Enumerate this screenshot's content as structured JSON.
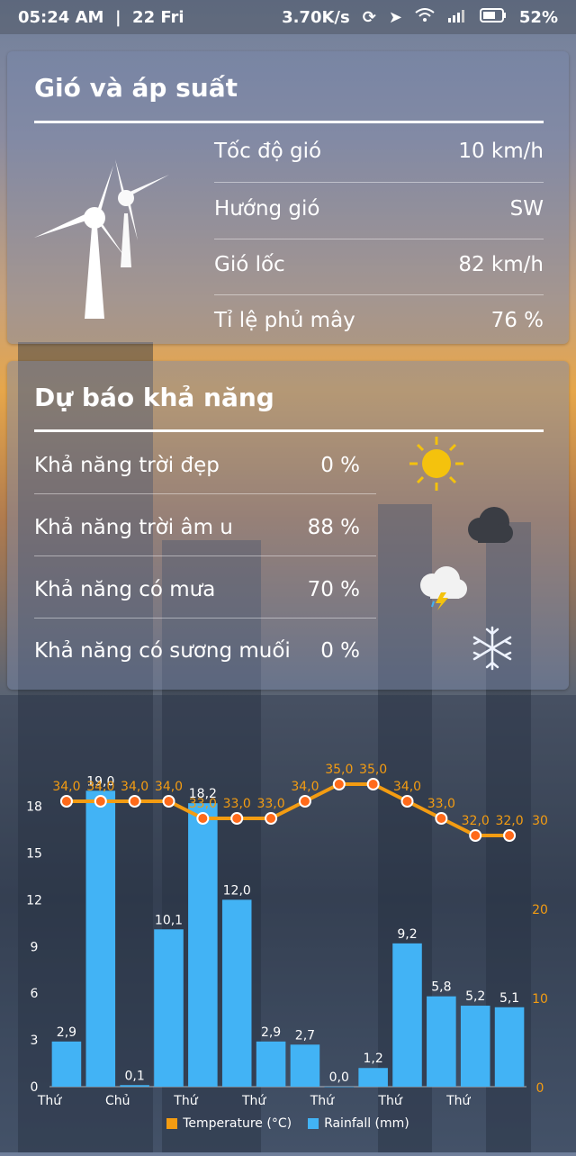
{
  "status_bar": {
    "time_date": "05:24 AM  |  22 Fri",
    "speed": "3.70K/s",
    "battery": "52%"
  },
  "wind_card": {
    "title": "Gió và áp suất",
    "icon": "wind-turbine-icon",
    "rows": [
      {
        "label": "Tốc độ gió",
        "value": "10 km/h"
      },
      {
        "label": "Hướng gió",
        "value": "SW"
      },
      {
        "label": "Gió lốc",
        "value": "82 km/h"
      },
      {
        "label": "Tỉ lệ phủ mây",
        "value": "76 %"
      }
    ]
  },
  "forecast_card": {
    "title": "Dự báo khả năng",
    "rows": [
      {
        "label": "Khả năng trời đẹp",
        "value": "0 %",
        "icon": "sun-icon"
      },
      {
        "label": "Khả năng trời âm u",
        "value": "88 %",
        "icon": "cloud-icon"
      },
      {
        "label": "Khả năng có mưa",
        "value": "70 %",
        "icon": "thunderstorm-icon"
      },
      {
        "label": "Khả năng có sương muối",
        "value": "0 %",
        "icon": "snowflake-icon"
      }
    ]
  },
  "colors": {
    "temperature": "#f39c12",
    "rainfall": "#42b3f5"
  },
  "chart_data": {
    "type": "bar+line",
    "x_tick_labels": [
      "Thứ",
      "Chủ",
      "Thứ",
      "Thứ",
      "Thứ",
      "Thứ",
      "Thứ"
    ],
    "series": [
      {
        "name": "Temperature (°C)",
        "type": "line",
        "axis": "right",
        "values": [
          34.0,
          34.0,
          34.0,
          34.0,
          33.0,
          33.0,
          33.0,
          34.0,
          35.0,
          35.0,
          34.0,
          33.0,
          32.0,
          32.0
        ],
        "labels": [
          "34,0",
          "34,0",
          "34,0",
          "34,0",
          "33,0",
          "33,0",
          "33,0",
          "34,0",
          "35,0",
          "35,0",
          "34,0",
          "33,0",
          "32,0",
          "32,0"
        ]
      },
      {
        "name": "Rainfall (mm)",
        "type": "bar",
        "axis": "left",
        "values": [
          2.9,
          19.0,
          0.1,
          10.1,
          18.2,
          12.0,
          2.9,
          2.7,
          0.0,
          1.2,
          9.2,
          5.8,
          5.2,
          5.1
        ],
        "labels": [
          "2,9",
          "19,0",
          "0,1",
          "10,1",
          "18,2",
          "12,0",
          "2,9",
          "2,7",
          "0,0",
          "1,2",
          "9,2",
          "5,8",
          "5,2",
          "5,1"
        ]
      }
    ],
    "left_axis": {
      "ticks": [
        "0",
        "3",
        "6",
        "9",
        "12",
        "15",
        "18"
      ],
      "ylim": [
        0,
        21
      ]
    },
    "right_axis": {
      "ticks": [
        "0",
        "10",
        "20",
        "30"
      ]
    },
    "legend": [
      "Temperature (°C)",
      "Rainfall (mm)"
    ],
    "legend_position": "bottom"
  }
}
